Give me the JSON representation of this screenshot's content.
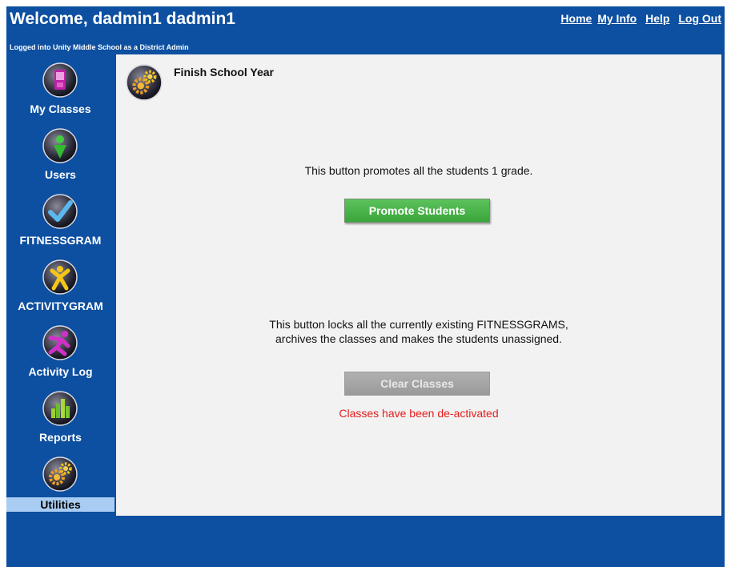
{
  "header": {
    "welcome": "Welcome, dadmin1 dadmin1",
    "logged_in": "Logged into Unity Middle School as a District Admin",
    "nav": {
      "home": "Home",
      "my_info": "My Info",
      "help": "Help",
      "log_out": "Log Out"
    }
  },
  "sidebar": {
    "items": [
      {
        "label": "My Classes",
        "icon": "phone-icon"
      },
      {
        "label": "Users",
        "icon": "user-pin-icon"
      },
      {
        "label": "FITNESSGRAM",
        "icon": "checkmark-icon"
      },
      {
        "label": "ACTIVITYGRAM",
        "icon": "person-icon"
      },
      {
        "label": "Activity Log",
        "icon": "runner-icon"
      },
      {
        "label": "Reports",
        "icon": "bar-chart-icon"
      },
      {
        "label": "Utilities",
        "icon": "gears-icon",
        "active": true
      }
    ]
  },
  "main": {
    "title": "Finish School Year",
    "promote": {
      "description": "This button promotes all the students 1 grade.",
      "button_label": "Promote Students"
    },
    "clear": {
      "description_line1": "This button locks all the currently existing FITNESSGRAMS,",
      "description_line2": "archives the classes and makes the students unassigned.",
      "button_label": "Clear Classes",
      "status": "Classes have been de-activated"
    }
  },
  "colors": {
    "frame_blue": "#0d4fa0",
    "active_tab": "#a9cdf2",
    "promote_green": "#4cb84c",
    "disabled_gray": "#a6a6a6",
    "status_red": "#e41c1c"
  }
}
